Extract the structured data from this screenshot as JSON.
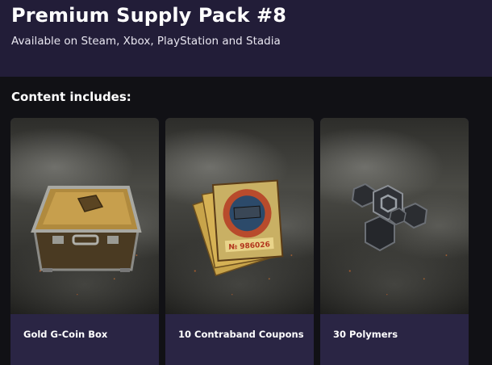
{
  "header": {
    "title": "Premium Supply Pack #8",
    "subtitle": "Available on Steam, Xbox, PlayStation and Stadia"
  },
  "content": {
    "heading": "Content includes:",
    "items": [
      {
        "label": "Gold G-Coin Box",
        "icon": "gold-coin-box-icon"
      },
      {
        "label": "10 Contraband Coupons",
        "icon": "contraband-coupons-icon",
        "coupon_number": "№ 986026"
      },
      {
        "label": "30 Polymers",
        "icon": "polymers-icon"
      }
    ]
  },
  "colors": {
    "header_bg": "#221d38",
    "card_footer_bg": "#2a2544",
    "page_bg": "#111115"
  }
}
